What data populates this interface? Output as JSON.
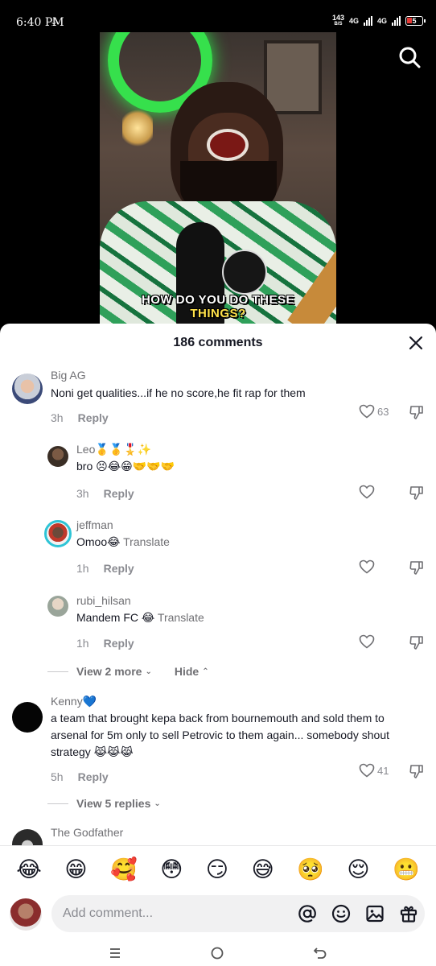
{
  "status_bar": {
    "time": "6:40 PM",
    "net_speed_top": "143",
    "net_speed_bottom": "B/S",
    "network_1": "4G",
    "network_2": "4G",
    "battery": "5"
  },
  "video": {
    "caption_line1": "HOW DO YOU DO THESE",
    "caption_line2": "THINGS?"
  },
  "sheet": {
    "title": "186 comments",
    "input_placeholder": "Add comment..."
  },
  "comments": [
    {
      "user": "Big AG",
      "text": "Noni get qualities...if he no score,he fit rap for them",
      "time": "3h",
      "reply_label": "Reply",
      "likes": "63"
    },
    {
      "user": "Leo🥇🥇🎖️✨",
      "text": "bro 😣😂😁🤝🤝🤝",
      "time": "3h",
      "reply_label": "Reply",
      "likes": ""
    },
    {
      "user": "jeffman",
      "text": "Omoo😂",
      "translate": "Translate",
      "time": "1h",
      "reply_label": "Reply",
      "likes": ""
    },
    {
      "user": "rubi_hilsan",
      "text": "Mandem FC 😂",
      "translate": "Translate",
      "time": "1h",
      "reply_label": "Reply",
      "likes": ""
    },
    {
      "user": "Kenny💙",
      "text_line1": "a team that brought kepa back from bournemouth and sold them to",
      "text_line2": "arsenal for 5m only to sell Petrovic to them again... somebody shout",
      "text_line3": "strategy 😹😹😹",
      "time": "5h",
      "reply_label": "Reply",
      "likes": "41"
    },
    {
      "user": "The Godfather"
    }
  ],
  "threads": {
    "view_more": "View 2 more",
    "hide": "Hide",
    "view_replies": "View 5 replies"
  },
  "emoji_bar": [
    "😂",
    "😁",
    "🥰",
    "😳",
    "😏",
    "😅",
    "🥺",
    "😌",
    "😬"
  ]
}
